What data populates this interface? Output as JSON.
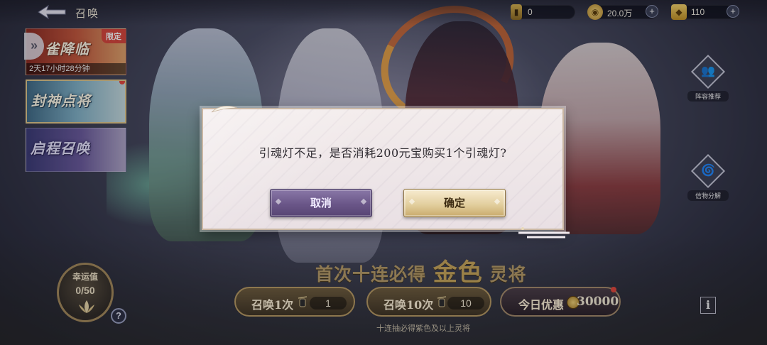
{
  "header": {
    "title": "召唤",
    "resources": [
      {
        "icon": "lamp-ticket-icon",
        "value": "0"
      },
      {
        "icon": "copper-coin-icon",
        "value": "20.0万"
      },
      {
        "icon": "gold-ingot-icon",
        "value": "110"
      }
    ],
    "plus": "+"
  },
  "banners": [
    {
      "name": "雀降临",
      "tag": "限定",
      "timer": "2天17小时28分钟"
    },
    {
      "name": "封神点将"
    },
    {
      "name": "启程召唤"
    }
  ],
  "side_arrow": "»",
  "side_buttons": [
    {
      "label": "阵容推荐"
    },
    {
      "label": "信物分解"
    }
  ],
  "headline": {
    "pre": "首次十连必得",
    "big": "金色",
    "post": "灵将"
  },
  "luck": {
    "label": "幸运值",
    "value": "0/50"
  },
  "help": "?",
  "info": "i",
  "pulls": [
    {
      "label": "召唤1次",
      "count": "1"
    },
    {
      "label": "召唤10次",
      "count": "10"
    },
    {
      "label": "今日优惠",
      "count": "30000"
    }
  ],
  "sub_note": "十连抽必得紫色及以上灵将",
  "dialog": {
    "message": "引魂灯不足，是否消耗200元宝购买1个引魂灯?",
    "cancel": "取消",
    "confirm": "确定"
  }
}
